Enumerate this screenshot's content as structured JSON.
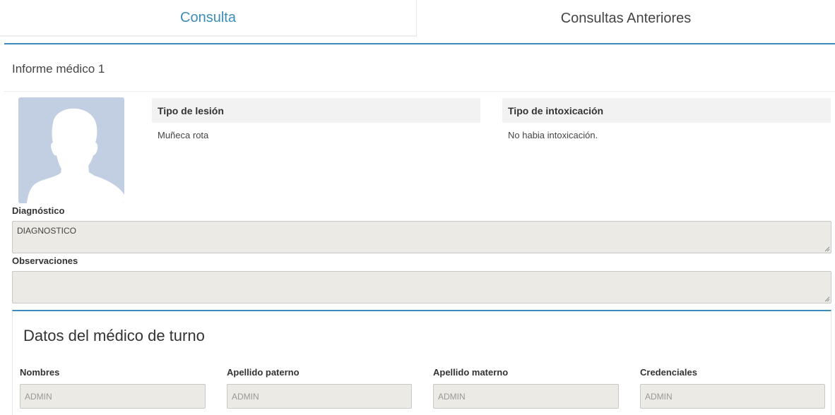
{
  "tabs": [
    {
      "label": "Consulta",
      "active": true
    },
    {
      "label": "Consultas Anteriores",
      "active": false
    }
  ],
  "report": {
    "title": "Informe médico 1",
    "avatar_icon": "user-silhouette-icon",
    "tipo_lesion": {
      "label": "Tipo de lesión",
      "value": "Muñeca rota"
    },
    "tipo_intoxicacion": {
      "label": "Tipo de intoxicación",
      "value": "No habia intoxicación."
    },
    "diagnostico": {
      "label": "Diagnóstico",
      "value": "DIAGNOSTICO"
    },
    "observaciones": {
      "label": "Observaciones",
      "value": ""
    }
  },
  "doctor": {
    "title": "Datos del médico de turno",
    "fields": [
      {
        "label": "Nombres",
        "placeholder": "ADMIN"
      },
      {
        "label": "Apellido paterno",
        "placeholder": "ADMIN"
      },
      {
        "label": "Apellido materno",
        "placeholder": "ADMIN"
      },
      {
        "label": "Credenciales",
        "placeholder": "ADMIN"
      }
    ]
  },
  "colors": {
    "accent": "#3c8dbc",
    "readonly_bg": "#ebeae4",
    "avatar_bg": "#c2cfe3"
  }
}
